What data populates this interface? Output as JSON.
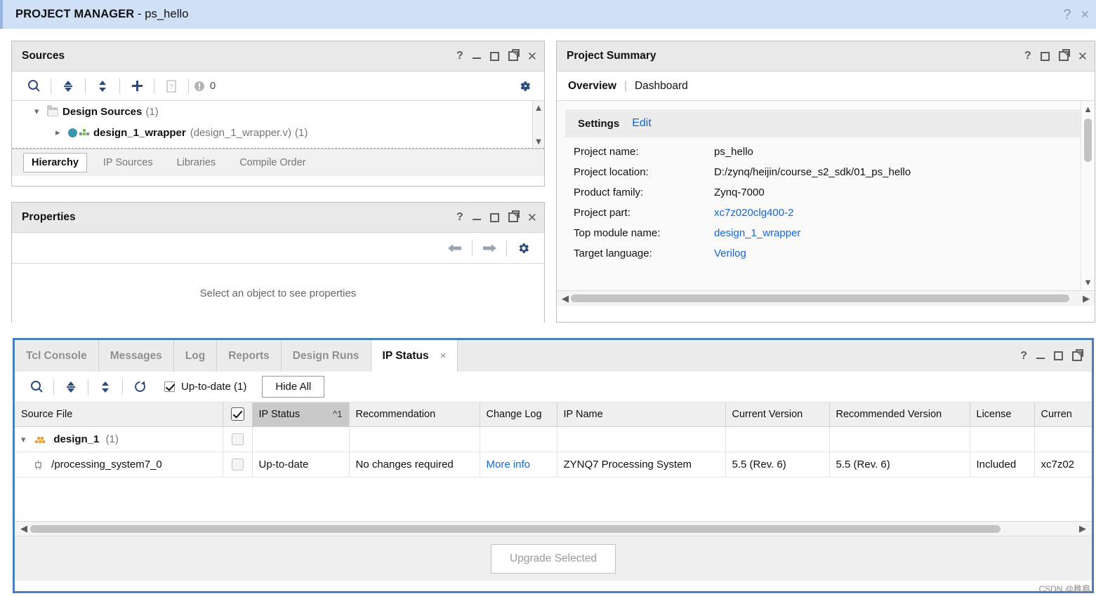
{
  "titlebar": {
    "prefix": "PROJECT MANAGER",
    "separator": " - ",
    "project": "ps_hello",
    "help_icon": "?",
    "close_icon": "×"
  },
  "sources_panel": {
    "title": "Sources",
    "toolbar": {
      "search_icon": "search-icon",
      "collapse_icon": "collapse-all-icon",
      "expand_icon": "expand-all-icon",
      "add_icon": "+",
      "report_icon": "report-icon",
      "badge_count": "0"
    },
    "tree": [
      {
        "label": "Design Sources",
        "count": "(1)"
      },
      {
        "label": "design_1_wrapper",
        "file": "(design_1_wrapper.v)",
        "count": "(1)"
      }
    ],
    "tabs": [
      {
        "label": "Hierarchy",
        "active": true
      },
      {
        "label": "IP Sources",
        "active": false
      },
      {
        "label": "Libraries",
        "active": false
      },
      {
        "label": "Compile Order",
        "active": false
      }
    ]
  },
  "properties_panel": {
    "title": "Properties",
    "empty_message": "Select an object to see properties"
  },
  "summary_panel": {
    "title": "Project Summary",
    "tabs": [
      {
        "label": "Overview",
        "selected": true
      },
      {
        "label": "Dashboard",
        "selected": false
      }
    ],
    "tab_divider": "|",
    "settings_label": "Settings",
    "edit_link": "Edit",
    "rows": [
      {
        "key": "Project name:",
        "value": "ps_hello",
        "link": false
      },
      {
        "key": "Project location:",
        "value": "D:/zynq/heijin/course_s2_sdk/01_ps_hello",
        "link": false
      },
      {
        "key": "Product family:",
        "value": "Zynq-7000",
        "link": false
      },
      {
        "key": "Project part:",
        "value": "xc7z020clg400-2",
        "link": true
      },
      {
        "key": "Top module name:",
        "value": "design_1_wrapper",
        "link": true
      },
      {
        "key": "Target language:",
        "value": "Verilog",
        "link": true
      }
    ]
  },
  "bottom_panel": {
    "tabs": [
      {
        "label": "Tcl Console",
        "active": false
      },
      {
        "label": "Messages",
        "active": false
      },
      {
        "label": "Log",
        "active": false
      },
      {
        "label": "Reports",
        "active": false
      },
      {
        "label": "Design Runs",
        "active": false
      },
      {
        "label": "IP Status",
        "active": true,
        "close_icon": "×"
      }
    ],
    "toolbar": {
      "search_icon": "search-icon",
      "collapse_icon": "collapse-all-icon",
      "expand_icon": "expand-all-icon",
      "refresh_icon": "refresh-icon",
      "filter_label": "Up-to-date (1)",
      "filter_checked": true,
      "hide_all_label": "Hide All"
    },
    "table": {
      "columns": [
        "Source File",
        "",
        "IP Status",
        "Recommendation",
        "Change Log",
        "IP Name",
        "Current Version",
        "Recommended Version",
        "License",
        "Curren"
      ],
      "sorted_column": "IP Status",
      "sort_indicator": "^",
      "sort_order": "1",
      "header_checkbox_checked": true,
      "rows": [
        {
          "source_file": "design_1",
          "source_count": "(1)",
          "icon": "design-blocks-icon",
          "expanded": true,
          "checked": false,
          "ip_status": "",
          "recommendation": "",
          "change_log": "",
          "ip_name": "",
          "current_version": "",
          "recommended_version": "",
          "license": "",
          "current_part": ""
        },
        {
          "source_file": "/processing_system7_0",
          "source_count": "",
          "icon": "ip-core-icon",
          "expanded": false,
          "checked": false,
          "ip_status": "Up-to-date",
          "recommendation": "No changes required",
          "change_log": "More info",
          "change_log_link": true,
          "ip_name": "ZYNQ7 Processing System",
          "current_version": "5.5 (Rev. 6)",
          "recommended_version": "5.5 (Rev. 6)",
          "license": "Included",
          "current_part": "xc7z02"
        }
      ]
    },
    "footer": {
      "upgrade_label": "Upgrade Selected",
      "upgrade_disabled": true
    }
  },
  "watermark": "CSDN @稚肩",
  "colors": {
    "titlebar_bg": "#cfe0f7",
    "focus_border": "#4a7ebb",
    "link": "#1565d8",
    "icon_blue": "#2c4a7c",
    "sorted_header": "#c9c9c9"
  }
}
